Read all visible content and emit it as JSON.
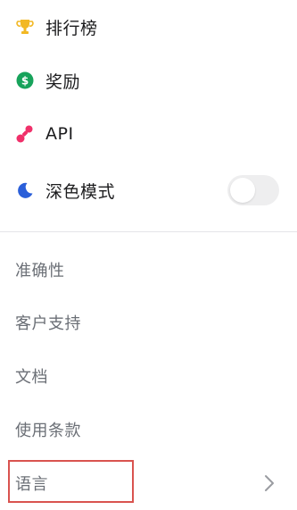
{
  "menu": {
    "top_items": [
      {
        "label": "排行榜",
        "icon": "trophy-icon"
      },
      {
        "label": "奖励",
        "icon": "dollar-coin-icon"
      },
      {
        "label": "API",
        "icon": "api-link-icon"
      },
      {
        "label": "深色模式",
        "icon": "moon-icon"
      }
    ],
    "dark_mode_enabled": false,
    "sub_items": [
      {
        "label": "准确性"
      },
      {
        "label": "客户支持"
      },
      {
        "label": "文档"
      },
      {
        "label": "使用条款"
      },
      {
        "label": "语言",
        "icon": "chevron-right-icon"
      }
    ]
  },
  "colors": {
    "trophy": "#F2B824",
    "coin": "#17A35B",
    "api": "#F0306A",
    "moon": "#2B5FD9",
    "highlight_border": "#D9534F"
  }
}
